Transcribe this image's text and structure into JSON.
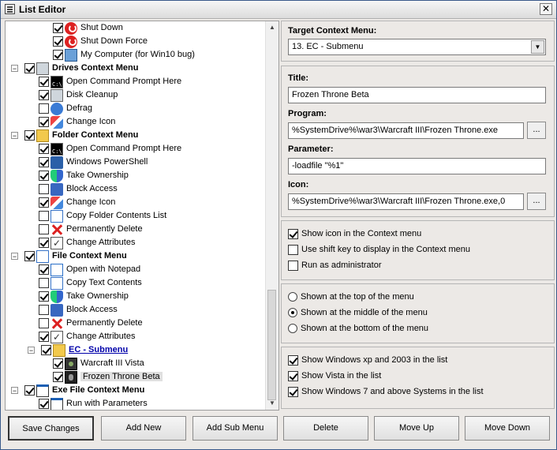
{
  "window": {
    "title": "List Editor",
    "close_glyph": "✕"
  },
  "tree": {
    "scrollbar": {
      "up_arrow": "▲",
      "down_arrow": "▼"
    },
    "nodes": [
      {
        "label": "Shut Down",
        "checked": true,
        "icon": "power-icon"
      },
      {
        "label": "Shut Down Force",
        "checked": true,
        "icon": "power-icon"
      },
      {
        "label": "My Computer (for Win10 bug)",
        "checked": true,
        "icon": "computer-icon"
      },
      {
        "label": "Drives Context Menu",
        "checked": true,
        "group": true,
        "expander": "−"
      },
      {
        "label": "Open Command Prompt Here",
        "checked": true,
        "icon": "cmd-icon"
      },
      {
        "label": "Disk Cleanup",
        "checked": true,
        "icon": "disk-cleanup-icon"
      },
      {
        "label": "Defrag",
        "checked": false,
        "icon": "defrag-icon"
      },
      {
        "label": "Change Icon",
        "checked": true,
        "icon": "change-icon-icon"
      },
      {
        "label": "Folder Context Menu",
        "checked": true,
        "group": true,
        "expander": "−"
      },
      {
        "label": "Open Command Prompt Here",
        "checked": true,
        "icon": "cmd-icon"
      },
      {
        "label": "Windows PowerShell",
        "checked": true,
        "icon": "powershell-icon"
      },
      {
        "label": "Take Ownership",
        "checked": true,
        "icon": "shield-icon"
      },
      {
        "label": "Block Access",
        "checked": false,
        "icon": "lock-icon"
      },
      {
        "label": "Change Icon",
        "checked": true,
        "icon": "change-icon-icon"
      },
      {
        "label": "Copy Folder Contents List",
        "checked": false,
        "icon": "document-icon"
      },
      {
        "label": "Permanently Delete",
        "checked": false,
        "icon": "delete-x-icon"
      },
      {
        "label": "Change Attributes",
        "checked": true,
        "icon": "attributes-icon"
      },
      {
        "label": "File Context Menu",
        "checked": true,
        "group": true,
        "expander": "−"
      },
      {
        "label": "Open with Notepad",
        "checked": true,
        "icon": "notepad-icon"
      },
      {
        "label": "Copy Text Contents",
        "checked": false,
        "icon": "document-icon"
      },
      {
        "label": "Take Ownership",
        "checked": true,
        "icon": "shield-icon"
      },
      {
        "label": "Block Access",
        "checked": false,
        "icon": "lock-icon"
      },
      {
        "label": "Permanently Delete",
        "checked": false,
        "icon": "delete-x-icon"
      },
      {
        "label": "Change Attributes",
        "checked": true,
        "icon": "attributes-icon"
      },
      {
        "label": "EC - Submenu",
        "checked": true,
        "submenu": true,
        "expander": "−",
        "icon": "folder-icon"
      },
      {
        "label": "Warcraft III Vista",
        "checked": true,
        "icon": "warcraft-icon"
      },
      {
        "label": "Frozen Throne Beta",
        "checked": true,
        "icon": "frozen-throne-icon",
        "selected": true
      },
      {
        "label": "Exe File Context Menu",
        "checked": true,
        "group": true,
        "expander": "−"
      },
      {
        "label": "Run with Parameters",
        "checked": true,
        "icon": "exe-icon"
      }
    ]
  },
  "target": {
    "label": "Target Context Menu:",
    "value": "13. EC - Submenu",
    "arrow": "▼"
  },
  "fields": {
    "title_label": "Title:",
    "title_value": "Frozen Throne Beta",
    "program_label": "Program:",
    "program_value": "%SystemDrive%\\war3\\Warcraft III\\Frozen Throne.exe",
    "parameter_label": "Parameter:",
    "parameter_value": "-loadfile \"%1\"",
    "icon_label": "Icon:",
    "icon_value": "%SystemDrive%\\war3\\Warcraft III\\Frozen Throne.exe,0",
    "browse_label": "..."
  },
  "options": {
    "show_icon": {
      "label": "Show icon in the Context menu",
      "checked": true
    },
    "shift_key": {
      "label": "Use shift key to display in the Context menu",
      "checked": false
    },
    "run_admin": {
      "label": "Run as administrator",
      "checked": false
    }
  },
  "position": {
    "top": {
      "label": "Shown at the top of the menu",
      "selected": false
    },
    "middle": {
      "label": "Shown at the middle of the menu",
      "selected": true
    },
    "bottom": {
      "label": "Shown at the bottom of the menu",
      "selected": false
    }
  },
  "os": {
    "xp": {
      "label": "Show Windows xp  and 2003 in the list",
      "checked": true
    },
    "vista": {
      "label": "Show Vista in the list",
      "checked": true
    },
    "win7": {
      "label": "Show Windows 7 and above Systems in the list",
      "checked": true
    }
  },
  "buttons": {
    "save": "Save Changes",
    "add_new": "Add New",
    "add_sub": "Add Sub Menu",
    "delete": "Delete",
    "move_up": "Move Up",
    "move_down": "Move Down"
  }
}
